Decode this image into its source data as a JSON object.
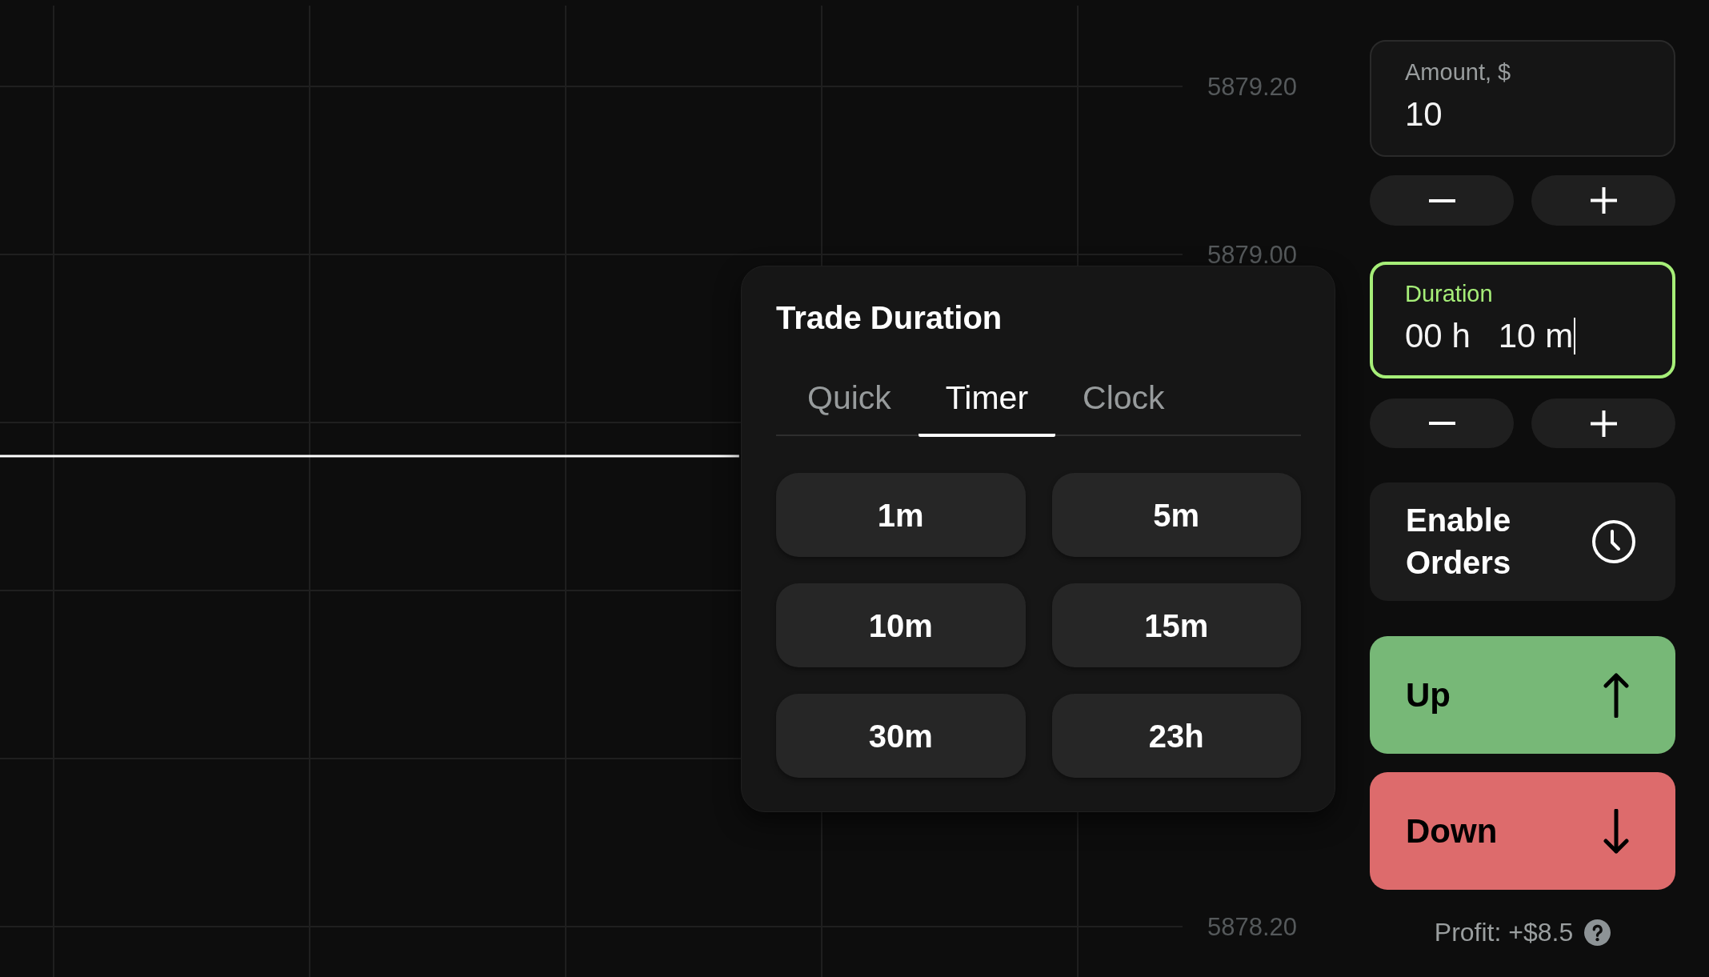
{
  "chart": {
    "chart_data": {
      "type": "line",
      "grid": true,
      "categories": [
        null,
        null,
        null,
        null,
        null,
        null,
        null,
        null,
        null
      ],
      "ylim": [
        5878.2,
        5879.2
      ],
      "yticks": [
        {
          "value": 5879.2,
          "label": "5879.20"
        },
        {
          "value": 5879.0,
          "label": "5879.00"
        },
        {
          "value": 5878.2,
          "label": "5878.20"
        }
      ],
      "series": [
        {
          "color": "#ffffff",
          "values": [
            5878.76,
            5878.76,
            5878.76,
            5878.76,
            5878.76,
            5878.76,
            null,
            null,
            null
          ]
        }
      ]
    }
  },
  "trade_duration_popup": {
    "title": "Trade Duration",
    "tabs": [
      {
        "label": "Quick",
        "selected": false
      },
      {
        "label": "Timer",
        "selected": true
      },
      {
        "label": "Clock",
        "selected": false
      }
    ],
    "presets": [
      "1m",
      "5m",
      "10m",
      "15m",
      "30m",
      "23h"
    ]
  },
  "order_panel": {
    "fields": [
      {
        "label": "Amount, $",
        "value": "10",
        "focused": false
      },
      {
        "label": "Duration",
        "value": "00 h   10 m",
        "focused": true
      }
    ],
    "enable_orders": {
      "label": "Enable Orders"
    },
    "trade_buttons": [
      {
        "kind": "up",
        "label": "Up",
        "color": "#77b877"
      },
      {
        "kind": "down",
        "label": "Down",
        "color": "#dd6b6c"
      }
    ],
    "profit": {
      "text": "Profit: +$8.5"
    }
  }
}
